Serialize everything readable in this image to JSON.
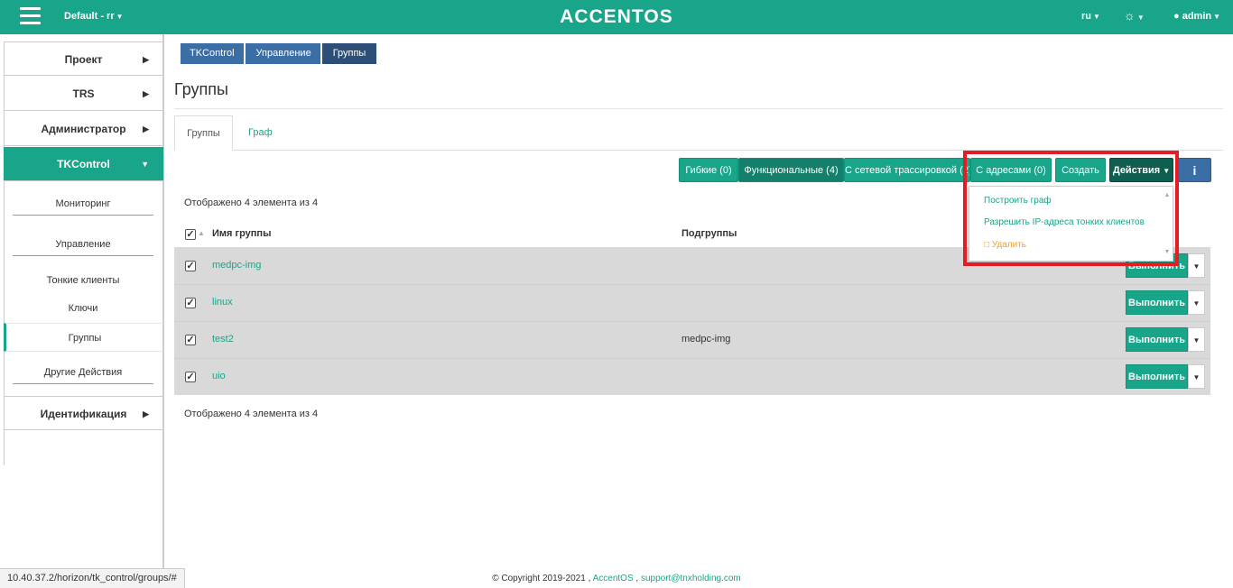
{
  "topbar": {
    "project": "Default - rr",
    "logo": "ACCENTOS",
    "lang": "ru",
    "user": "admin",
    "colors": {
      "accent": "#18a589",
      "danger": "#e51c23"
    }
  },
  "sidebar": {
    "items": [
      {
        "label": "Проект"
      },
      {
        "label": "TRS"
      },
      {
        "label": "Администратор"
      },
      {
        "label": "TKControl"
      },
      {
        "label": "Идентификация"
      }
    ],
    "sub": {
      "monitoring": "Мониторинг",
      "management": "Управление",
      "thin_clients": "Тонкие клиенты",
      "keys": "Ключи",
      "groups": "Группы",
      "other": "Другие Действия"
    }
  },
  "breadcrumb": [
    "TKControl",
    "Управление",
    "Группы"
  ],
  "page": {
    "title": "Группы"
  },
  "tabs": [
    "Группы",
    "Граф"
  ],
  "filters": {
    "flexible": "Гибкие (0)",
    "functional": "Функциональные (4)",
    "traced": "С сетевой трассировкой (2)",
    "addressed": "С адресами (0)",
    "create": "Создать",
    "actions": "Действия",
    "info": "i"
  },
  "dropdown": {
    "build_graph": "Построить граф",
    "resolve_ip": "Разрешить IP-адреса тонких клиентов",
    "delete": "Удалить"
  },
  "table": {
    "count_text": "Отображено 4 элемента из 4",
    "headers": {
      "name": "Имя группы",
      "subgroups": "Подгруппы"
    },
    "rows": [
      {
        "name": "medpc-img",
        "subgroups": ""
      },
      {
        "name": "linux",
        "subgroups": ""
      },
      {
        "name": "test2",
        "subgroups": "medpc-img"
      },
      {
        "name": "uio",
        "subgroups": ""
      }
    ],
    "action_label": "Выполнить"
  },
  "footer": {
    "copyright": "© Copyright 2019-2021 ,",
    "brand": "AccentOS",
    "separator": ",",
    "email": "support@tnxholding.com"
  },
  "statusbar": {
    "url": "10.40.37.2/horizon/tk_control/groups/#"
  }
}
